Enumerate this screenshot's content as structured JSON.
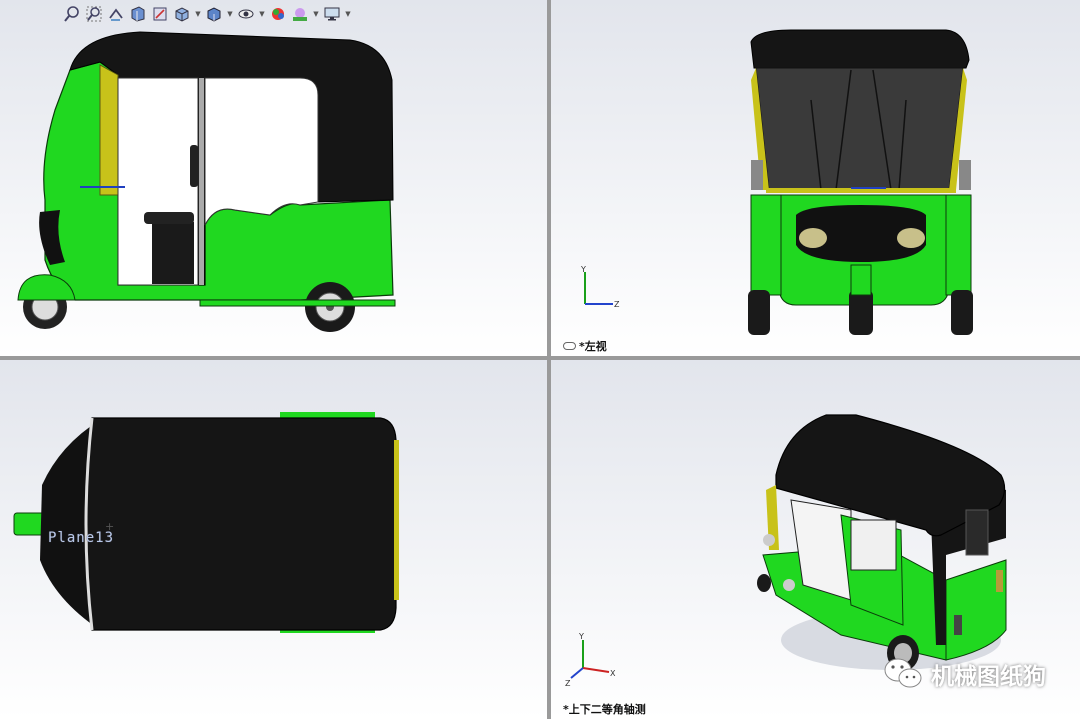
{
  "toolbar": {
    "tools": [
      "zoom-to-fit-icon",
      "zoom-to-area-icon",
      "previous-view-icon",
      "section-view-icon",
      "dynamic-annotation-icon",
      "view-orientation-icon",
      "display-style-icon",
      "hide-show-items-icon",
      "edit-appearance-icon",
      "apply-scene-icon",
      "view-settings-icon"
    ]
  },
  "viewports": {
    "top_left": {
      "label": ""
    },
    "top_right": {
      "label": "*左视"
    },
    "bottom_left": {
      "label": "",
      "plane_label": "Plane13"
    },
    "bottom_right": {
      "label": "*上下二等角轴测"
    }
  },
  "triad": {
    "x": "X",
    "y": "Y",
    "z": "Z"
  },
  "watermark": {
    "text": "机械图纸狗"
  },
  "colors": {
    "body_green": "#20e020",
    "roof_black": "#151515",
    "frame_yellow": "#c8c21a",
    "viewport_bg_top": "#e2e5ec",
    "divider": "#9a9a9a"
  }
}
